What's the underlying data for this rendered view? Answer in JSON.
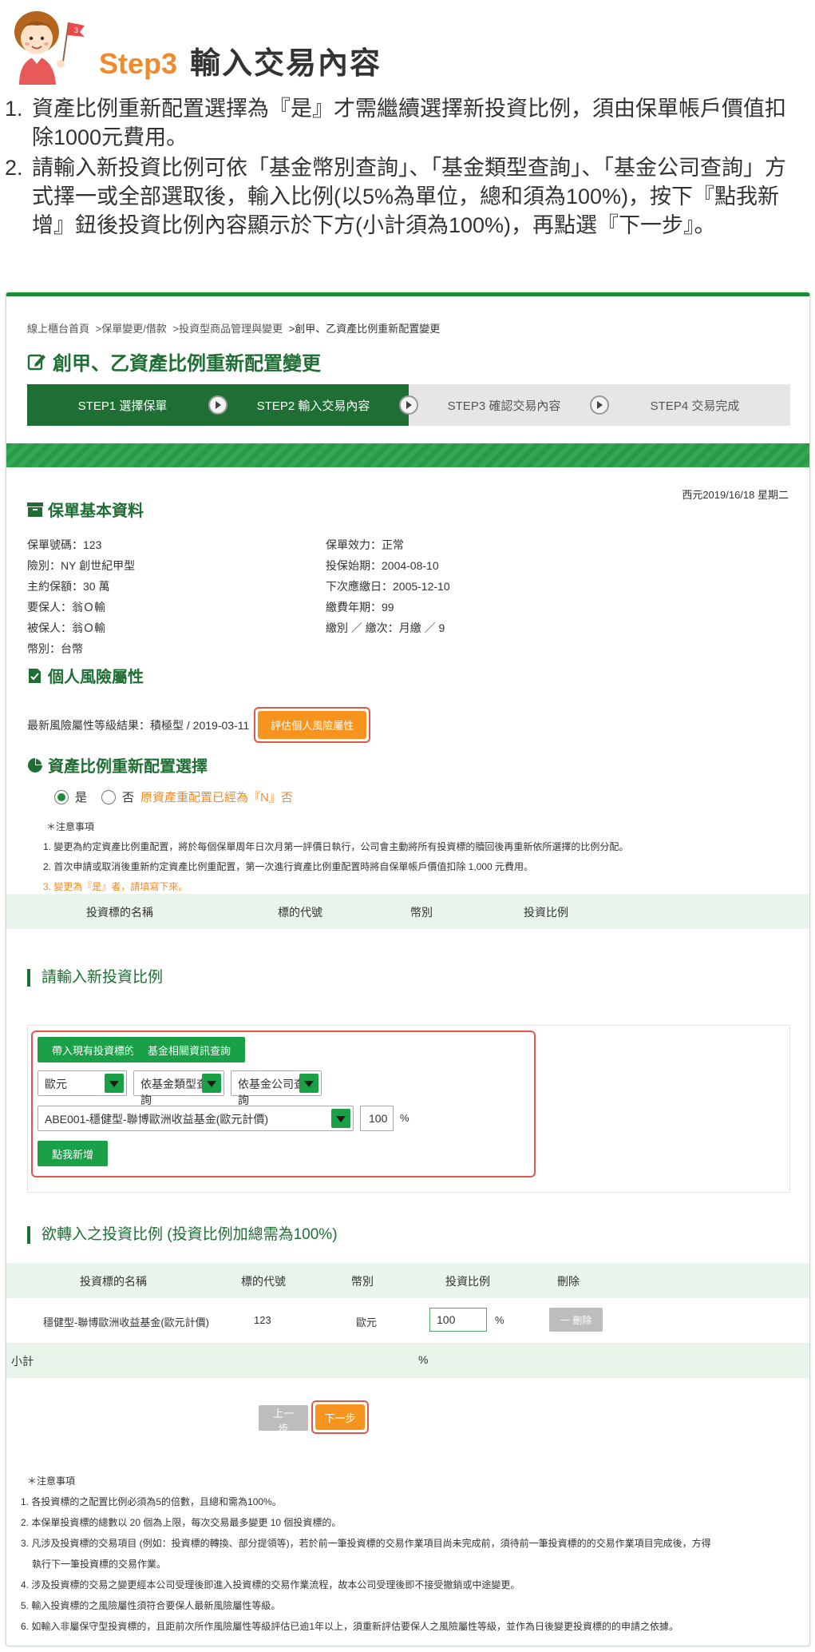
{
  "header": {
    "step_no": "Step3",
    "step_name": "輸入交易內容",
    "flag_number": "3"
  },
  "instructions": [
    {
      "num": "1.",
      "text": "資產比例重新配置選擇為『是』才需繼續選擇新投資比例，須由保單帳戶價值扣除1000元費用。"
    },
    {
      "num": "2.",
      "text": "請輸入新投資比例可依「基金幣別查詢」、「基金類型查詢」、「基金公司查詢」方式擇一或全部選取後，輸入比例(以5%為單位，總和須為100%)，按下『點我新增』鈕後投資比例內容顯示於下方(小計須為100%)，再點選『下一步』。"
    }
  ],
  "breadcrumb": [
    "線上櫃台首頁",
    ">保單變更/借款",
    ">投資型商品管理與變更",
    ">創甲、乙資產比例重新配置變更"
  ],
  "page_title": "創甲、乙資產比例重新配置變更",
  "steps": [
    {
      "label": "STEP1 選擇保單",
      "state": "done"
    },
    {
      "label": "STEP2 輸入交易內容",
      "state": "done"
    },
    {
      "label": "STEP3 確認交易內容",
      "state": "todo"
    },
    {
      "label": "STEP4 交易完成",
      "state": "todo"
    }
  ],
  "policy": {
    "heading": "保單基本資料",
    "date": "西元2019/16/18 星期二",
    "left": [
      "保單號碼：123",
      "險別：NY 創世紀甲型",
      "主約保額：30 萬",
      "要保人：翁Ｏ輸",
      "被保人：翁Ｏ輸",
      "幣別：台幣"
    ],
    "right": [
      "保單效力：正常",
      "投保始期：2004-08-10",
      "下次應繳日：2005-12-10",
      "繳費年期：99",
      "繳別 ／ 繳次：月繳 ／ 9"
    ]
  },
  "risk": {
    "heading": "個人風險屬性",
    "result": "最新風險屬性等級結果：積極型 / 2019-03-11",
    "button": "評估個人風險屬性"
  },
  "realloc": {
    "heading": "資產比例重新配置選擇",
    "yes": "是",
    "no": "否",
    "note_orange": "原資產重配置已經為『N』否",
    "notes_title": "＊注意事項",
    "notes": [
      "1. 變更為約定資產比例重配置，將於每個保單周年日次月第一評價日執行，公司會主動將所有投資標的贖回後再重新依所選擇的比例分配。",
      "2. 首次申請或取消後重新約定資產比例重配置，第一次進行資產比例重配置時將自保單帳戶價值扣除 1,000 元費用。",
      "3. 變更為『是』者，請填寫下來。"
    ]
  },
  "current_table": {
    "headers": [
      "投資標的名稱",
      "標的代號",
      "幣別",
      "投資比例"
    ]
  },
  "new_ratio": {
    "heading": "請輸入新投資比例",
    "btn_import": "帶入現有投資標的",
    "btn_fund_info": "基金相關資訊查詢",
    "currency": "歐元",
    "fund_type": "依基金類型查詢",
    "fund_company": "依基金公司查詢",
    "fund": "ABE001-穩健型-聯博歐洲收益基金(歐元計價)",
    "ratio": "100",
    "pct": "%",
    "btn_add": "點我新增"
  },
  "target_table": {
    "heading": "欲轉入之投資比例 (投資比例加總需為100%)",
    "headers": [
      "投資標的名稱",
      "標的代號",
      "幣別",
      "投資比例",
      "刪除"
    ],
    "rows": [
      {
        "name": "穩健型-聯博歐洲收益基金(歐元計價)",
        "code": "123",
        "currency": "歐元",
        "ratio": "100",
        "pct": "%",
        "delete": "一 刪除"
      }
    ],
    "subtotal_label": "小計",
    "subtotal_pct": "%"
  },
  "nav": {
    "prev": "上一步",
    "next": "下一步"
  },
  "footer_notes": {
    "title": "＊注意事項",
    "items": [
      "1. 各投資標的之配置比例必須為5的倍數，且總和需為100%。",
      "2. 本保單投資標的總數以 20 個為上限，每次交易最多變更 10 個投資標的。",
      "3. 凡涉及投資標的交易項目 (例如：投資標的轉換、部分提領等)，若於前一筆投資標的交易作業項目尚未完成前，須待前一筆投資標的的交易作業項目完成後，方得",
      "執行下一筆投資標的交易作業。",
      "4. 涉及投資標的交易之變更經本公司受理後即進入投資標的交易作業流程，故本公司受理後即不接受撤銷或中途變更。",
      "5. 輸入投資標的之風險屬性須符合要保人最新風險屬性等級。",
      "6. 如輸入非屬保守型投資標的，且距前次所作風險屬性等級評估已逾1年以上，須重新評估要保人之風險屬性等級，並作為日後變更投資標的的申請之依據。"
    ]
  },
  "colors": {
    "brand_green": "#1f6f34",
    "accent_orange": "#f7941d",
    "highlight_red": "#e0584c"
  }
}
